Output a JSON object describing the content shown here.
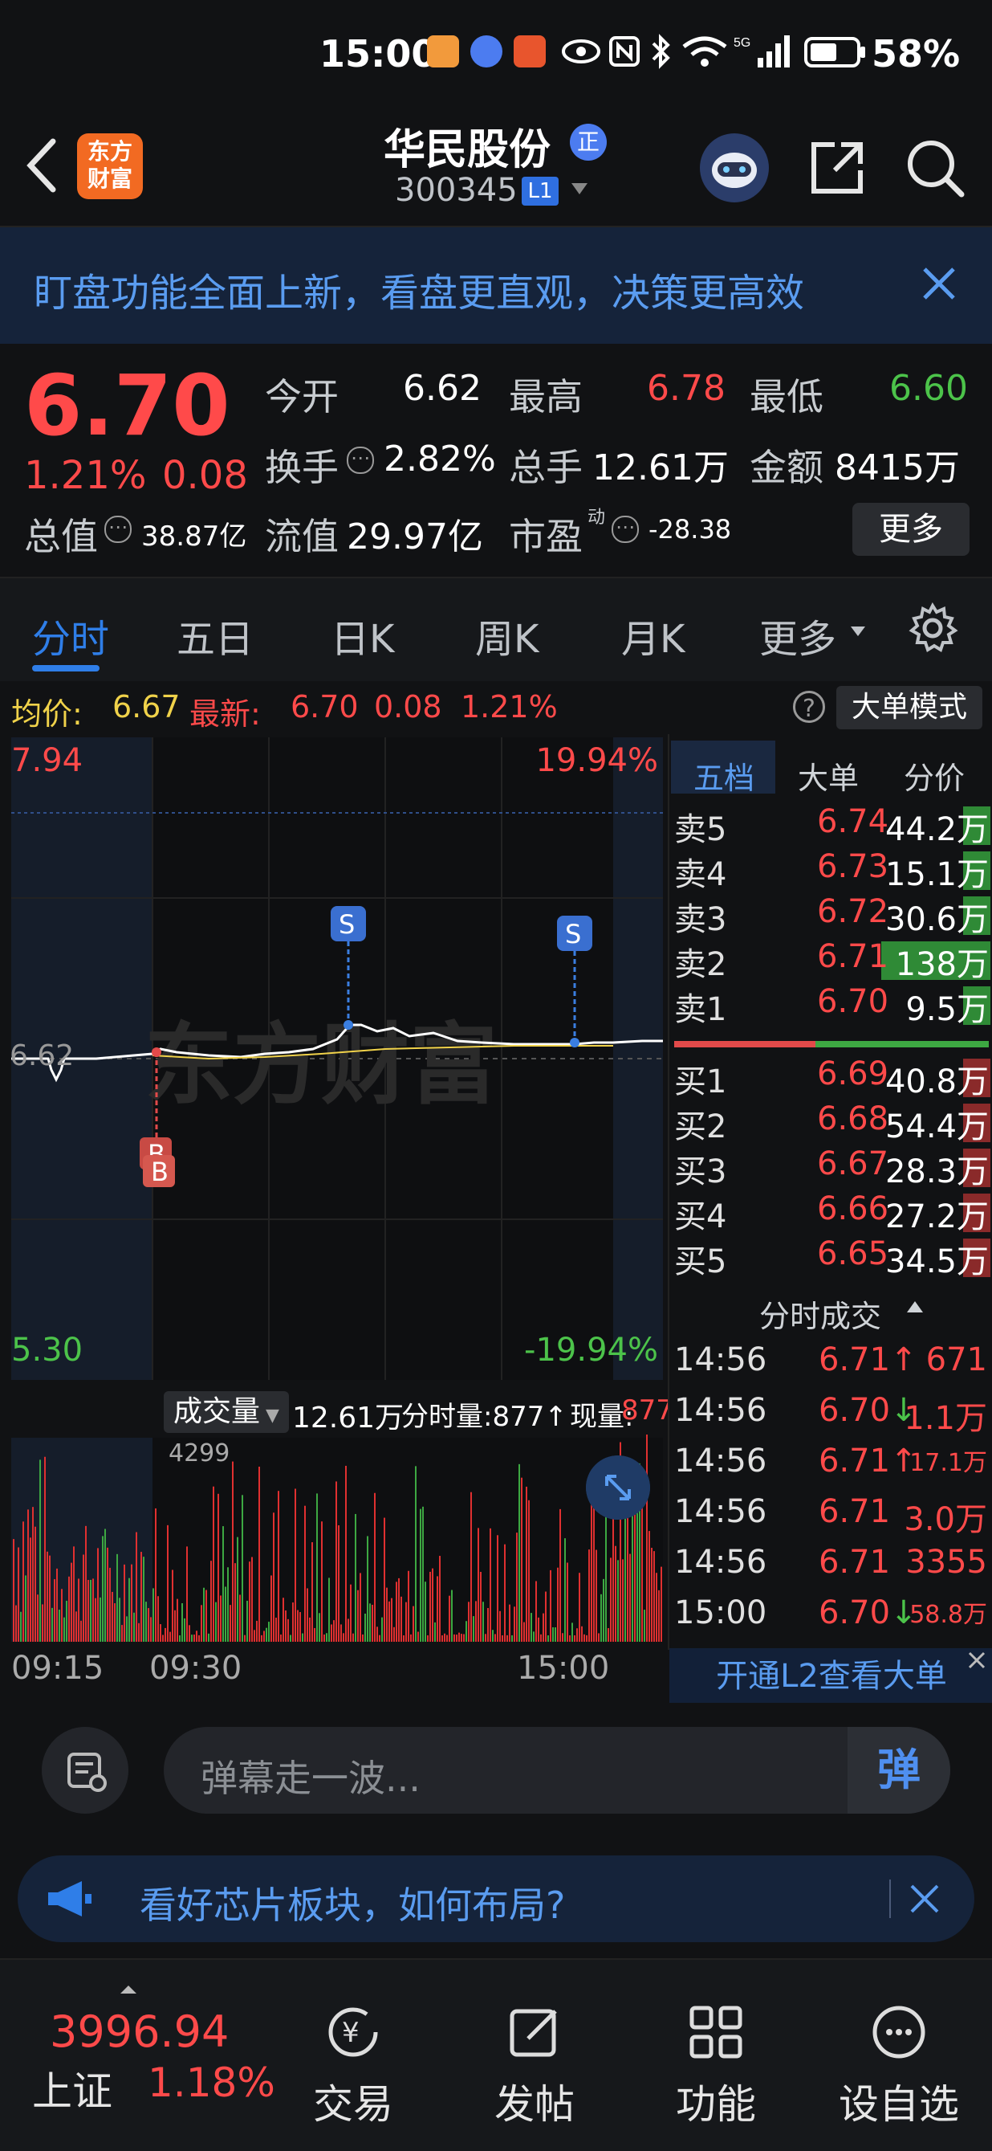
{
  "status_bar": {
    "time": "15:00",
    "battery": "58%"
  },
  "header": {
    "logo_text": "东方财富",
    "stock_name": "华民股份",
    "badge": "正",
    "stock_code": "300345",
    "level": "L1"
  },
  "banner": {
    "text": "盯盘功能全面上新，看盘更直观，决策更高效"
  },
  "quote": {
    "price": "6.70",
    "pct_change": "1.21%",
    "abs_change": "0.08",
    "open_label": "今开",
    "open": "6.62",
    "high_label": "最高",
    "high": "6.78",
    "low_label": "最低",
    "low": "6.60",
    "turnover_label": "换手",
    "turnover": "2.82%",
    "volume_label": "总手",
    "volume": "12.61万",
    "amount_label": "金额",
    "amount": "8415万",
    "mktcap_label": "总值",
    "mktcap": "38.87亿",
    "float_label": "流值",
    "float": "29.97亿",
    "pe_label": "市盈",
    "pe_sup": "动",
    "pe": "-28.38",
    "more": "更多"
  },
  "tabs": [
    "分时",
    "五日",
    "日K",
    "周K",
    "月K",
    "更多"
  ],
  "info_line": {
    "avg_label": "均价:",
    "avg": "6.67",
    "latest_label": "最新:",
    "latest": "6.70",
    "latest_chg": "0.08",
    "latest_pct": "1.21%",
    "mode_btn": "大单模式"
  },
  "chart": {
    "y_max": "7.94",
    "y_max_pct": "19.94%",
    "y_min": "5.30",
    "y_min_pct": "-19.94%",
    "y_open": "6.62",
    "watermark": "东方财富",
    "markers": {
      "buy": "B",
      "sell": "S"
    },
    "volume_dropdown": "成交量",
    "volume_total": "12.61万",
    "volume_slice_label": "分时量:877↑",
    "volume_now_label": "现量:",
    "volume_now": "877",
    "volume_scale": "4299",
    "time_labels": [
      "09:15",
      "09:30",
      "15:00"
    ]
  },
  "book": {
    "tabs": [
      "五档",
      "大单",
      "分价"
    ],
    "asks": [
      {
        "label": "卖5",
        "price": "6.74",
        "vol": "44.2万"
      },
      {
        "label": "卖4",
        "price": "6.73",
        "vol": "15.1万"
      },
      {
        "label": "卖3",
        "price": "6.72",
        "vol": "30.6万"
      },
      {
        "label": "卖2",
        "price": "6.71",
        "vol": "138万"
      },
      {
        "label": "卖1",
        "price": "6.70",
        "vol": "9.5万"
      }
    ],
    "bids": [
      {
        "label": "买1",
        "price": "6.69",
        "vol": "40.8万"
      },
      {
        "label": "买2",
        "price": "6.68",
        "vol": "54.4万"
      },
      {
        "label": "买3",
        "price": "6.67",
        "vol": "28.3万"
      },
      {
        "label": "买4",
        "price": "6.66",
        "vol": "27.2万"
      },
      {
        "label": "买5",
        "price": "6.65",
        "vol": "34.5万"
      }
    ],
    "ticks_header": "分时成交",
    "ticks": [
      {
        "time": "14:56",
        "price": "6.71",
        "dir": "↑",
        "vol": "671",
        "color": "red"
      },
      {
        "time": "14:56",
        "price": "6.70",
        "dir": "↓",
        "vol": "1.1万",
        "color": "red"
      },
      {
        "time": "14:56",
        "price": "6.71",
        "dir": "↑",
        "vol": "17.1万",
        "color": "red"
      },
      {
        "time": "14:56",
        "price": "6.71",
        "dir": "",
        "vol": "3.0万",
        "color": "red"
      },
      {
        "time": "14:56",
        "price": "6.71",
        "dir": "",
        "vol": "3355",
        "color": "red"
      },
      {
        "time": "15:00",
        "price": "6.70",
        "dir": "↓",
        "vol": "58.8万",
        "color": "red"
      }
    ],
    "l2_link": "开通L2查看大单"
  },
  "danmaku": {
    "placeholder": "弹幕走一波...",
    "send": "弹"
  },
  "news": {
    "text": "看好芯片板块，如何布局?"
  },
  "bottom_nav": {
    "index_value": "3996.94",
    "index_name": "上证",
    "index_pct": "1.18%",
    "items": [
      "交易",
      "发帖",
      "功能",
      "设自选"
    ]
  },
  "colors": {
    "up": "#ff4a4a",
    "down": "#4cc34a",
    "accent": "#2f7ee8",
    "avg_line": "#f0d24a"
  }
}
